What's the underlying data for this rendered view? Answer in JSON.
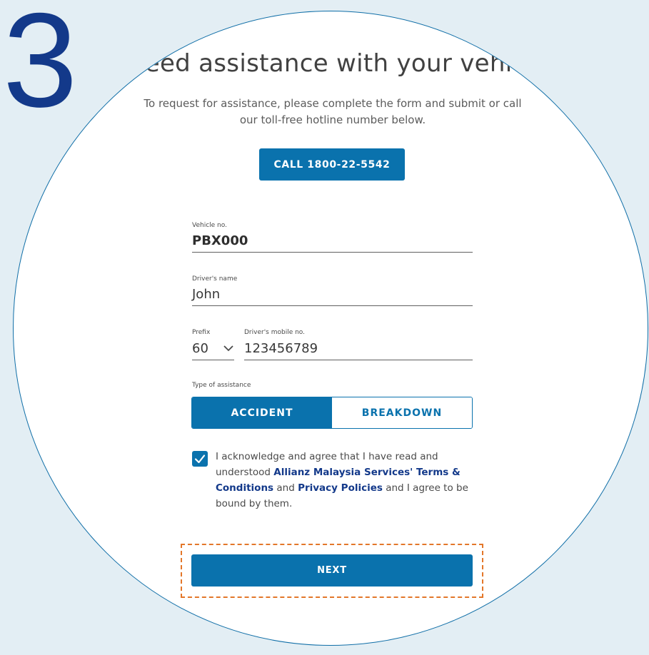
{
  "step": "3",
  "header": {
    "title": "Need assistance with your vehicle?",
    "subtitle": "To request for assistance, please complete the form and submit or call our toll-free hotline number below."
  },
  "call_button": {
    "label": "CALL 1800-22-5542"
  },
  "form": {
    "vehicle": {
      "label": "Vehicle no.",
      "value": "PBX000"
    },
    "driver_name": {
      "label": "Driver's name",
      "value": "John"
    },
    "prefix": {
      "label": "Prefix",
      "value": "60"
    },
    "mobile": {
      "label": "Driver's mobile no.",
      "value": "123456789"
    },
    "assistance": {
      "label": "Type of assistance",
      "options": [
        "ACCIDENT",
        "BREAKDOWN"
      ],
      "selected": "ACCIDENT"
    }
  },
  "consent": {
    "checked": true,
    "text_1": "I acknowledge and agree that I have read and understood ",
    "link_terms": "Allianz Malaysia Services' Terms & Conditions",
    "text_2": " and ",
    "link_privacy": "Privacy Policies",
    "text_3": " and I agree to be bound by them."
  },
  "next_button": {
    "label": "NEXT"
  },
  "colors": {
    "primary": "#0a72ad",
    "brand_dark": "#13398a",
    "highlight": "#e3772a",
    "background": "#e3eef4"
  },
  "icons": {
    "prefix_dropdown": "chevron-down-icon",
    "checkbox": "checkmark-icon"
  }
}
